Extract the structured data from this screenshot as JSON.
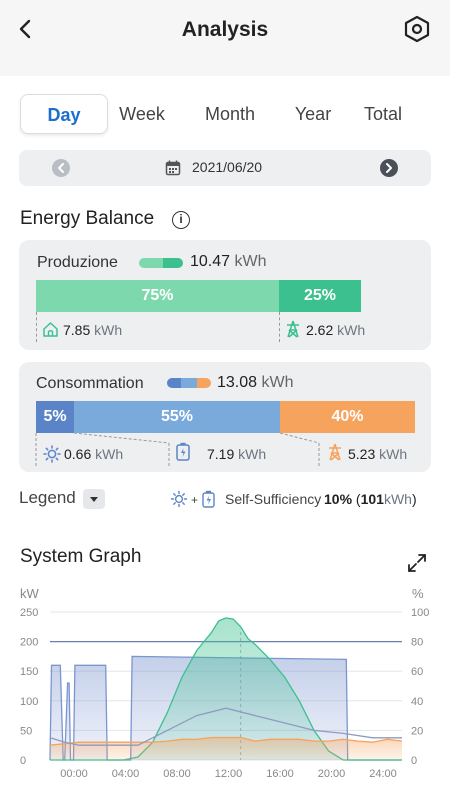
{
  "header": {
    "title": "Analysis",
    "back_icon": "chevron-left-icon",
    "settings_icon": "hexagon-settings-icon"
  },
  "tabs": [
    {
      "label": "Day",
      "active": true
    },
    {
      "label": "Week",
      "active": false
    },
    {
      "label": "Month",
      "active": false
    },
    {
      "label": "Year",
      "active": false
    },
    {
      "label": "Total",
      "active": false
    }
  ],
  "date_bar": {
    "date": "2021/06/20",
    "prev_icon": "chevron-left-circle-icon",
    "next_icon": "chevron-right-circle-icon",
    "calendar_icon": "calendar-icon"
  },
  "energy_balance": {
    "title": "Energy Balance",
    "info_icon": "info-icon",
    "production": {
      "label": "Produzione",
      "total_value": "10.47",
      "unit": "kWh",
      "segments": [
        {
          "pct": 75,
          "label": "75%",
          "color": "#7dd9ad"
        },
        {
          "pct": 25,
          "label": "25%",
          "color": "#3cc08f"
        }
      ],
      "home": {
        "value": "7.85",
        "unit": "kWh",
        "icon": "home-icon"
      },
      "grid": {
        "value": "2.62",
        "unit": "kWh",
        "icon": "grid-tower-icon"
      }
    },
    "consumption": {
      "label": "Consommation",
      "total_value": "13.08",
      "unit": "kWh",
      "segments": [
        {
          "pct": 5,
          "label": "5%",
          "color": "#5b84c8"
        },
        {
          "pct": 55,
          "label": "55%",
          "color": "#7aa9db"
        },
        {
          "pct": 40,
          "label": "40%",
          "color": "#f6a35e"
        }
      ],
      "solar": {
        "value": "0.66",
        "unit": "kWh",
        "icon": "sun-icon"
      },
      "battery": {
        "value": "7.19",
        "unit": "kWh",
        "icon": "battery-icon"
      },
      "grid": {
        "value": "5.23",
        "unit": "kWh",
        "icon": "grid-tower-icon"
      }
    }
  },
  "legend": {
    "label": "Legend",
    "caret_icon": "caret-down-icon",
    "ss_label": "Self-Sufficiency",
    "ss_pct": "10%",
    "ss_value": "101",
    "ss_unit": "kWh"
  },
  "system_graph": {
    "title": "System Graph",
    "expand_icon": "expand-icon"
  },
  "chart_data": {
    "type": "area",
    "left_axis": {
      "label": "kW",
      "ticks": [
        "250",
        "200",
        "150",
        "100",
        "50",
        "0"
      ],
      "ylim": [
        0,
        250
      ]
    },
    "right_axis": {
      "label": "%",
      "ticks": [
        "100",
        "80",
        "60",
        "40",
        "20",
        "0"
      ],
      "ylim": [
        0,
        100
      ]
    },
    "x_ticks": [
      "00:00",
      "04:00",
      "08:00",
      "12:00",
      "16:00",
      "20:00",
      "24:00"
    ],
    "reference_line_right": 80,
    "series": [
      {
        "color": "#7b95cf",
        "axis": "left",
        "x": [
          0,
          0.1,
          0.2,
          0.7,
          0.9,
          1.0,
          1.2,
          1.3,
          1.4,
          1.5,
          1.6,
          1.7,
          2.0,
          2.1,
          2.2,
          3.8,
          3.9,
          5.5,
          5.6,
          20.2,
          20.3,
          24
        ],
        "y": [
          0,
          160,
          160,
          160,
          0,
          0,
          130,
          130,
          0,
          0,
          0,
          160,
          160,
          160,
          160,
          160,
          0,
          0,
          175,
          170,
          0,
          0
        ]
      },
      {
        "color": "#3cc08f",
        "axis": "left",
        "x": [
          0,
          5,
          6,
          7,
          8,
          9,
          10,
          11,
          11.5,
          12,
          12.5,
          13,
          13.5,
          14,
          15,
          16,
          17,
          18,
          19,
          20,
          24
        ],
        "y": [
          0,
          0,
          5,
          30,
          80,
          140,
          185,
          215,
          235,
          240,
          238,
          225,
          205,
          195,
          170,
          140,
          100,
          50,
          15,
          0,
          0
        ]
      },
      {
        "color": "#f6a35e",
        "axis": "left",
        "x": [
          0,
          2,
          4,
          6,
          7,
          8,
          9,
          10,
          11,
          12,
          13,
          14,
          15,
          16,
          17,
          18,
          19,
          20,
          21,
          22,
          23,
          24
        ],
        "y": [
          25,
          30,
          30,
          30,
          30,
          32,
          35,
          35,
          38,
          38,
          38,
          32,
          35,
          35,
          35,
          32,
          32,
          35,
          32,
          30,
          35,
          32
        ]
      },
      {
        "color": "#8f9bbf",
        "axis": "right",
        "x": [
          0,
          1,
          2,
          4,
          6,
          8,
          10,
          12,
          14,
          16,
          18,
          20,
          22,
          24
        ],
        "y": [
          15,
          12,
          10,
          10,
          10,
          20,
          30,
          35,
          30,
          25,
          20,
          18,
          15,
          15
        ]
      }
    ]
  }
}
